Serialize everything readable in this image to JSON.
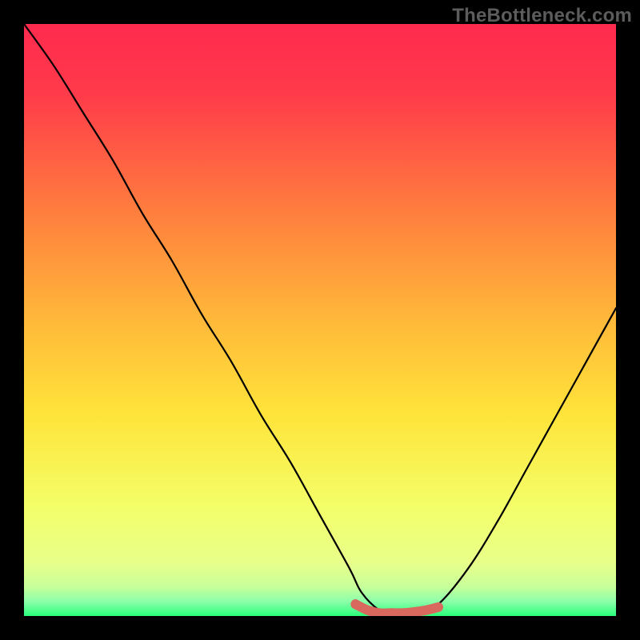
{
  "watermark": "TheBottleneck.com",
  "chart_data": {
    "type": "line",
    "title": "",
    "xlabel": "",
    "ylabel": "",
    "xlim": [
      0,
      100
    ],
    "ylim": [
      0,
      100
    ],
    "grid": false,
    "series": [
      {
        "name": "bottleneck-curve",
        "x": [
          0,
          5,
          10,
          15,
          20,
          25,
          30,
          35,
          40,
          45,
          50,
          55,
          57,
          60,
          63,
          66,
          70,
          75,
          80,
          85,
          90,
          95,
          100
        ],
        "y": [
          100,
          93,
          85,
          77,
          68,
          60,
          51,
          43,
          34,
          26,
          17,
          8,
          4,
          1,
          0,
          0,
          2,
          8,
          16,
          25,
          34,
          43,
          52
        ],
        "color": "#000000"
      },
      {
        "name": "optimal-band",
        "x": [
          56,
          58,
          60,
          62,
          64,
          66,
          68,
          70
        ],
        "y": [
          2,
          1,
          0.5,
          0.5,
          0.5,
          0.7,
          1,
          1.5
        ],
        "color": "#d9695f"
      }
    ],
    "background_gradient": {
      "top": "#ff2a4e",
      "upper_mid": "#ffb83a",
      "mid": "#ffe43a",
      "lower_mid": "#f3ff6a",
      "band": "#c8ff9a",
      "bottom": "#2aff7a"
    },
    "annotations": [
      {
        "type": "dot",
        "x": 56,
        "y": 2,
        "color": "#d9695f"
      }
    ]
  }
}
